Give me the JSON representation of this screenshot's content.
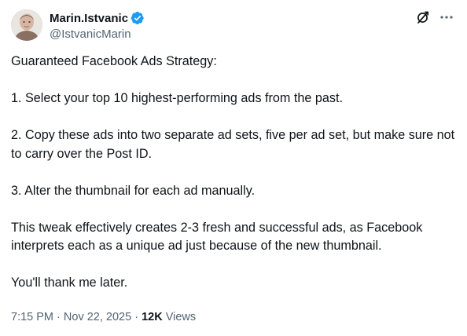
{
  "author": {
    "display_name": "Marin.Istvanic",
    "handle": "@IstvanicMarin",
    "verified": true,
    "verified_icon": "verified-badge-icon",
    "verified_color": "#1d9bf0"
  },
  "header_actions": {
    "grok_icon": "grok-icon",
    "more_icon": "more-options-icon"
  },
  "tweet": {
    "paragraphs": [
      "Guaranteed Facebook Ads Strategy:",
      "1. Select your top 10 highest-performing ads from the past.",
      "2. Copy these ads into two separate ad sets, five per ad set, but make sure not to carry over the Post ID.",
      "3. Alter the thumbnail for each ad manually.",
      "This tweak effectively creates 2-3 fresh and successful ads, as Facebook interprets each as a unique ad just because of the new thumbnail.",
      "You'll thank me later."
    ]
  },
  "meta": {
    "time": "7:15 PM",
    "separator": "·",
    "date": "Nov 22, 2025",
    "views_count": "12K",
    "views_label": "Views"
  },
  "colors": {
    "text_primary": "#0f1419",
    "text_secondary": "#536471",
    "accent": "#1d9bf0"
  }
}
